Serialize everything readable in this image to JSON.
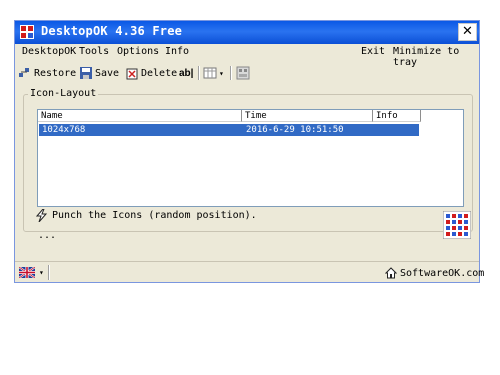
{
  "window": {
    "title": "DesktopOK 4.36 Free",
    "close_label": "✕"
  },
  "menu": {
    "left": [
      "DesktopOK",
      "Tools",
      "Options",
      "Info"
    ],
    "right": [
      "Exit",
      "Minimize to tray"
    ]
  },
  "toolbar": {
    "restore_label": "Restore",
    "save_label": "Save",
    "delete_label": "Delete",
    "rename_label": "ab|"
  },
  "group": {
    "label": "Icon-Layout"
  },
  "table": {
    "columns": [
      "Name",
      "Time",
      "Info"
    ],
    "rows": [
      {
        "name": "1024x768",
        "time": "2016-6-29 10:51:50",
        "info": ""
      }
    ]
  },
  "status": {
    "punch_text": "Punch the Icons (random position).",
    "dots": "..."
  },
  "footer": {
    "brand": "SoftwareOK.com"
  },
  "colors": {
    "title_bar": "#0a58e5",
    "selection": "#316ac5",
    "window_bg": "#ece9d8"
  },
  "icons": [
    "app-icon",
    "close-icon",
    "restore-icon",
    "save-icon",
    "delete-icon",
    "rename-icon",
    "view-icon",
    "settings-icon",
    "lightning-icon",
    "uk-flag-icon",
    "home-icon",
    "pixel-logo-icon"
  ]
}
